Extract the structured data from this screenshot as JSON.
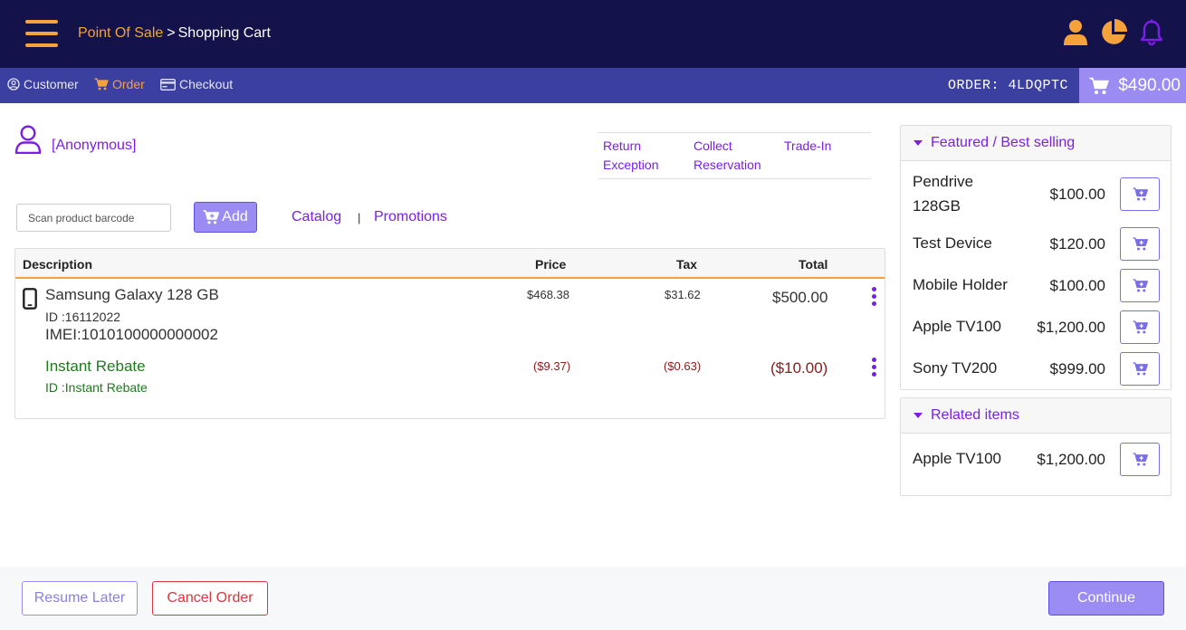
{
  "header": {
    "breadcrumb_root": "Point Of Sale",
    "breadcrumb_sep": ">",
    "breadcrumb_current": "Shopping Cart",
    "icons": [
      "user-icon",
      "pie-chart-icon",
      "bell-icon"
    ],
    "accent_color": "#f5a23a",
    "bg_color": "#13124a"
  },
  "subnav": {
    "customer_label": "Customer",
    "order_label": "Order",
    "checkout_label": "Checkout",
    "order_number": "ORDER: 4LDQPTC",
    "cart_total": "$490.00"
  },
  "customer": {
    "name": "[Anonymous]"
  },
  "actions": {
    "return_exception": [
      "Return",
      "Exception"
    ],
    "collect_reservation": [
      "Collect",
      "Reservation"
    ],
    "trade_in": "Trade-In"
  },
  "scan": {
    "placeholder": "Scan product barcode",
    "add_label": "Add",
    "catalog_label": "Catalog",
    "separator": "|",
    "promotions_label": "Promotions"
  },
  "cart_table": {
    "headers": {
      "description": "Description",
      "price": "Price",
      "tax": "Tax",
      "total": "Total"
    },
    "items": [
      {
        "name": "Samsung Galaxy 128 GB",
        "id_line": "ID :16112022",
        "imei_line": "IMEI:1010100000000002",
        "price": "$468.38",
        "tax": "$31.62",
        "total": "$500.00"
      },
      {
        "name": "Instant Rebate",
        "id_line": "ID :Instant Rebate",
        "price": "($9.37)",
        "tax": "($0.63)",
        "total": "($10.00)"
      }
    ]
  },
  "featured": {
    "title": "Featured / Best selling",
    "products": [
      {
        "name": "Pendrive 128GB",
        "price": "$100.00"
      },
      {
        "name": "Test Device",
        "price": "$120.00"
      },
      {
        "name": "Mobile Holder",
        "price": "$100.00"
      },
      {
        "name": "Apple TV100",
        "price": "$1,200.00"
      },
      {
        "name": "Sony TV200",
        "price": "$999.00"
      }
    ]
  },
  "related": {
    "title": "Related items",
    "products": [
      {
        "name": "Apple TV100",
        "price": "$1,200.00"
      }
    ]
  },
  "footer": {
    "resume_label": "Resume Later",
    "cancel_label": "Cancel Order",
    "continue_label": "Continue"
  }
}
